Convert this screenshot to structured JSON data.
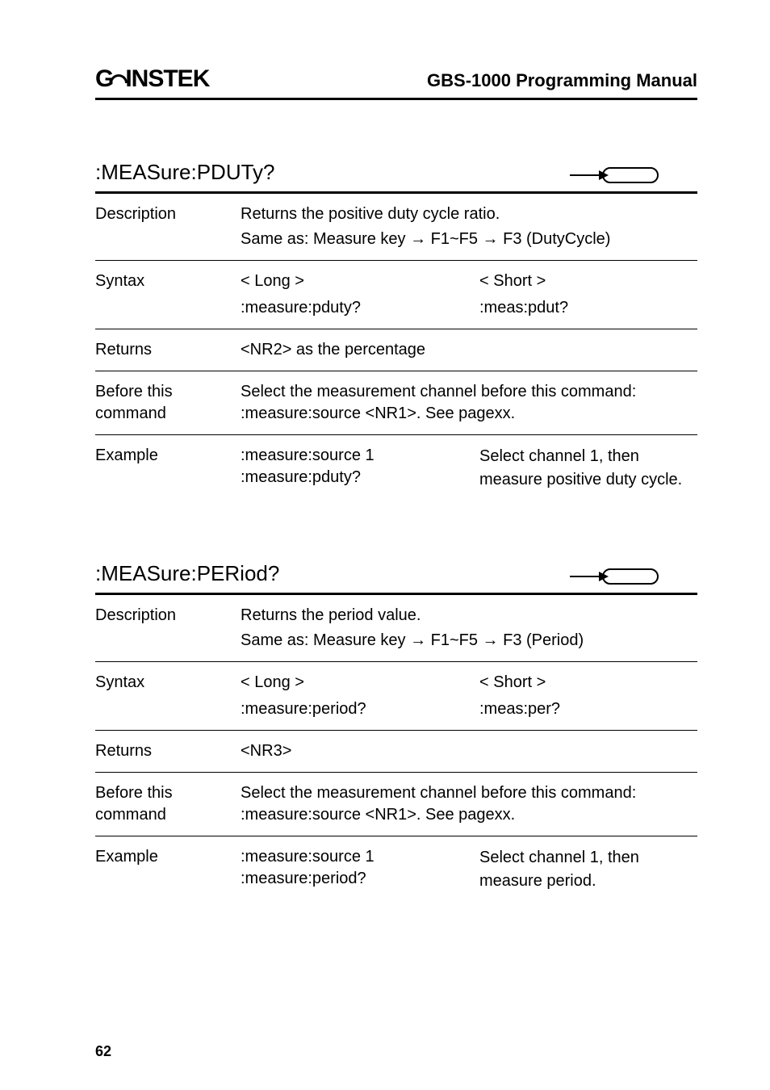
{
  "header": {
    "logo_left": "G",
    "logo_right": "INSTEK",
    "manual_title": "GBS-1000 Programming Manual"
  },
  "sections": [
    {
      "cmd": ":MEASure:PDUTy?",
      "description": {
        "line1": "Returns the positive duty cycle ratio.",
        "line2": "Same as: Measure key → F1~F5 → F3 (DutyCycle)"
      },
      "syntax": {
        "long_h": "< Long >",
        "short_h": "< Short >",
        "long_v": ":measure:pduty?",
        "short_v": ":meas:pdut?"
      },
      "returns": "<NR2> as the percentage",
      "before": "Select the measurement channel before this command: :measure:source <NR1>. See pagexx.",
      "example": {
        "c1a": ":measure:source 1",
        "c1b": ":measure:pduty?",
        "c2": "Select channel 1, then measure positive duty cycle."
      }
    },
    {
      "cmd": ":MEASure:PERiod?",
      "description": {
        "line1": "Returns the period value.",
        "line2": "Same as: Measure key → F1~F5 → F3 (Period)"
      },
      "syntax": {
        "long_h": "< Long >",
        "short_h": "< Short >",
        "long_v": ":measure:period?",
        "short_v": ":meas:per?"
      },
      "returns": "<NR3>",
      "before": "Select the measurement channel before this command: :measure:source <NR1>. See pagexx.",
      "example": {
        "c1a": ":measure:source 1",
        "c1b": ":measure:period?",
        "c2": "Select channel 1, then measure period."
      }
    }
  ],
  "labels": {
    "description": "Description",
    "syntax": "Syntax",
    "returns": "Returns",
    "before": "Before this command",
    "example": "Example"
  },
  "page_number": "62"
}
